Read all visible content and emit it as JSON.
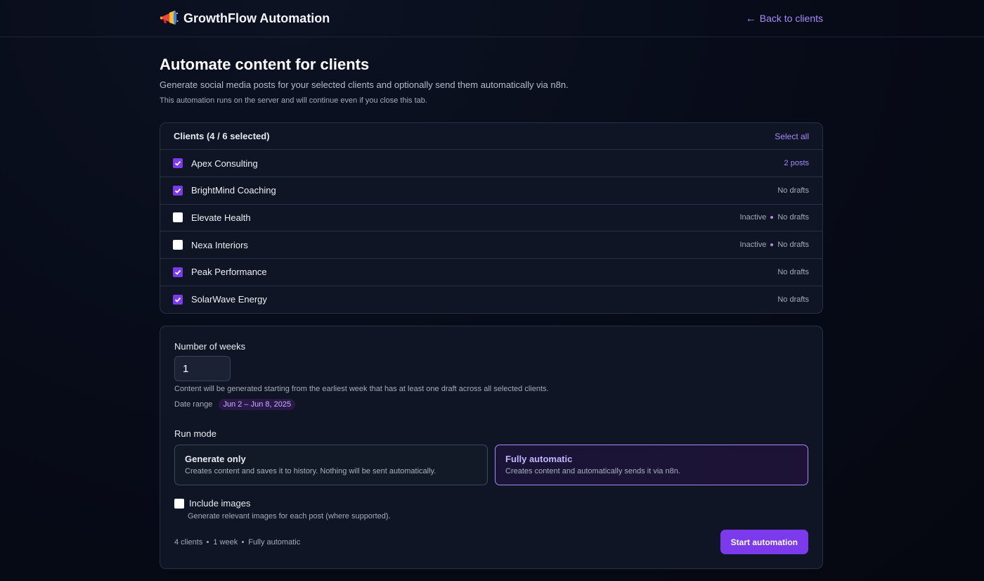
{
  "header": {
    "app_name": "GrowthFlow Automation",
    "logo_icon": "megaphone-icon",
    "back_label": "Back to clients",
    "back_icon": "arrow-left-icon"
  },
  "page": {
    "title": "Automate content for clients",
    "subtitle": "Generate social media posts for your selected clients and optionally send them automatically via n8n.",
    "note": "This automation runs on the server and will continue even if you close this tab."
  },
  "clients": {
    "heading": "Clients (4 / 6 selected)",
    "select_all_label": "Select all",
    "items": [
      {
        "name": "Apex Consulting",
        "checked": true,
        "status": "",
        "meta": "2 posts"
      },
      {
        "name": "BrightMind Coaching",
        "checked": true,
        "status": "",
        "meta": "No drafts"
      },
      {
        "name": "Elevate Health",
        "checked": false,
        "status": "Inactive",
        "meta": "No drafts"
      },
      {
        "name": "Nexa Interiors",
        "checked": false,
        "status": "Inactive",
        "meta": "No drafts"
      },
      {
        "name": "Peak Performance",
        "checked": true,
        "status": "",
        "meta": "No drafts"
      },
      {
        "name": "SolarWave Energy",
        "checked": true,
        "status": "",
        "meta": "No drafts"
      }
    ]
  },
  "settings": {
    "weeks_label": "Number of weeks",
    "weeks_value": "1",
    "weeks_hint": "Content will be generated starting from the earliest week that has at least one draft across all selected clients.",
    "date_range_label": "Date range",
    "date_range_value": "Jun 2 – Jun 8, 2025",
    "run_mode_label": "Run mode",
    "modes": [
      {
        "title": "Generate only",
        "desc": "Creates content and saves it to history. Nothing will be sent automatically.",
        "active": false
      },
      {
        "title": "Fully automatic",
        "desc": "Creates content and automatically sends it via n8n.",
        "active": true
      }
    ],
    "include_images_label": "Include images",
    "include_images_checked": false,
    "include_images_hint": "Generate relevant images for each post (where supported)."
  },
  "summary": {
    "clients": "4 clients",
    "weeks": "1 week",
    "mode": "Fully automatic"
  },
  "start_button_label": "Start automation",
  "colors": {
    "accent": "#7c3aed",
    "accent_light": "#a78bfa",
    "background": "#070b18",
    "card": "#0f1524"
  }
}
